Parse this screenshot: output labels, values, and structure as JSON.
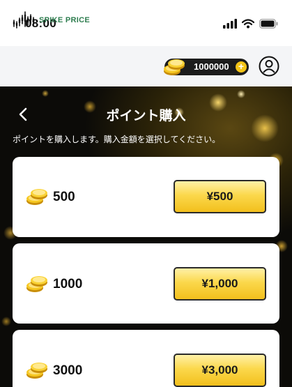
{
  "status_bar": {
    "time": "08:00"
  },
  "header": {
    "logo_text": "SPIKE PRICE",
    "balance": "1000000",
    "balance_plus": "+"
  },
  "page": {
    "title": "ポイント購入",
    "back_glyph": "‹",
    "subtitle": "ポイントを購入します。購入金額を選択してください。"
  },
  "packages": [
    {
      "points": "500",
      "price": "¥500"
    },
    {
      "points": "1000",
      "price": "¥1,000"
    },
    {
      "points": "3000",
      "price": "¥3,000"
    }
  ],
  "colors": {
    "brand_green": "#2e7d4f",
    "coin_gold": "#f3c417",
    "button_gold": "#fbd84c",
    "hero_dark": "#0b0b0b"
  },
  "icons": {
    "signal": "signal-icon",
    "wifi": "wifi-icon",
    "battery": "battery-icon",
    "logo": "spike-chart-icon",
    "coins": "coin-stack-icon",
    "plus": "plus-icon",
    "avatar": "user-avatar-icon",
    "back": "back-chevron-icon"
  }
}
